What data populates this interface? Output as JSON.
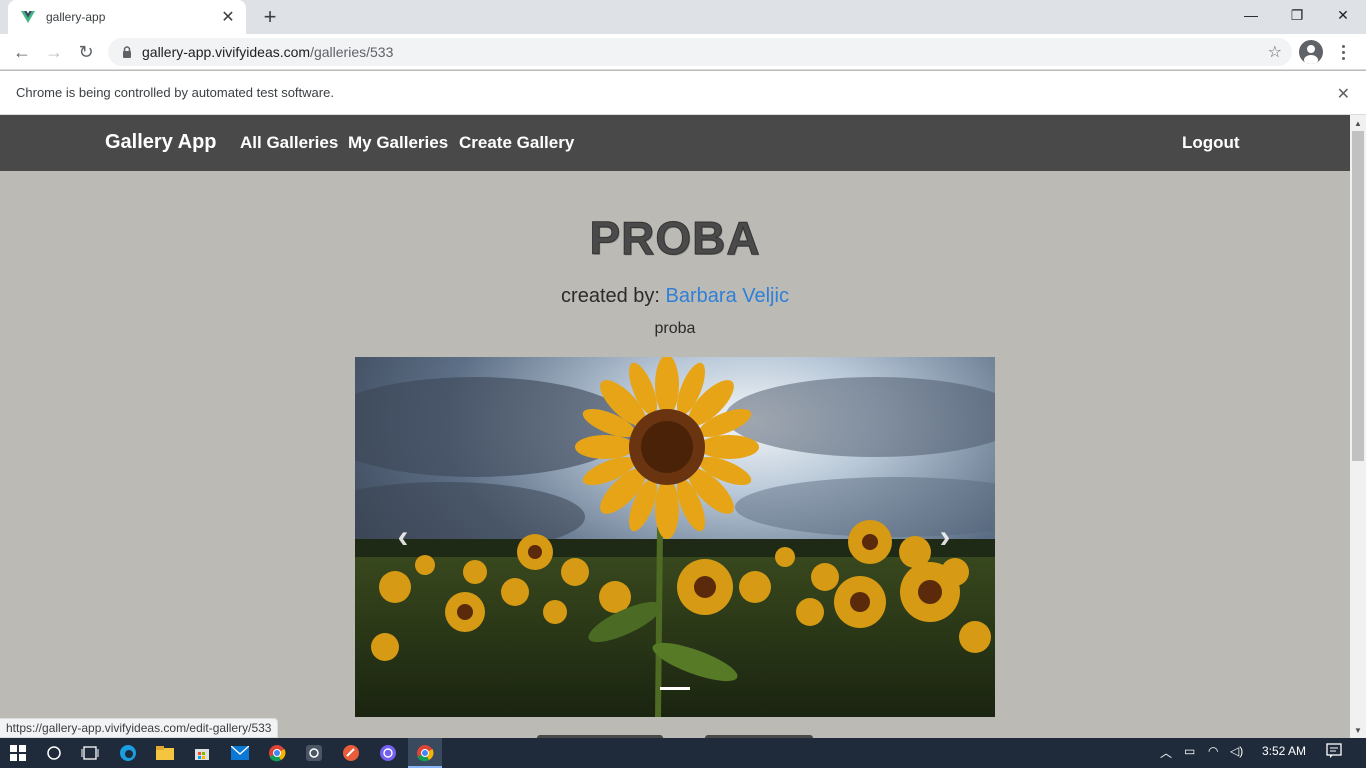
{
  "browser": {
    "tab_title": "gallery-app",
    "url_host": "gallery-app.vivifyideas.com",
    "url_path": "/galleries/533",
    "infobar_text": "Chrome is being controlled by automated test software.",
    "status_url": "https://gallery-app.vivifyideas.com/edit-gallery/533"
  },
  "navbar": {
    "brand": "Gallery App",
    "links": [
      "All Galleries",
      "My Galleries",
      "Create Gallery"
    ],
    "logout": "Logout"
  },
  "gallery": {
    "title": "PROBA",
    "created_by_label": "created by: ",
    "author": "Barbara Veljic",
    "description": "proba"
  },
  "carousel": {
    "prev_glyph": "‹",
    "next_glyph": "›"
  },
  "taskbar": {
    "time": "3:52 AM"
  }
}
